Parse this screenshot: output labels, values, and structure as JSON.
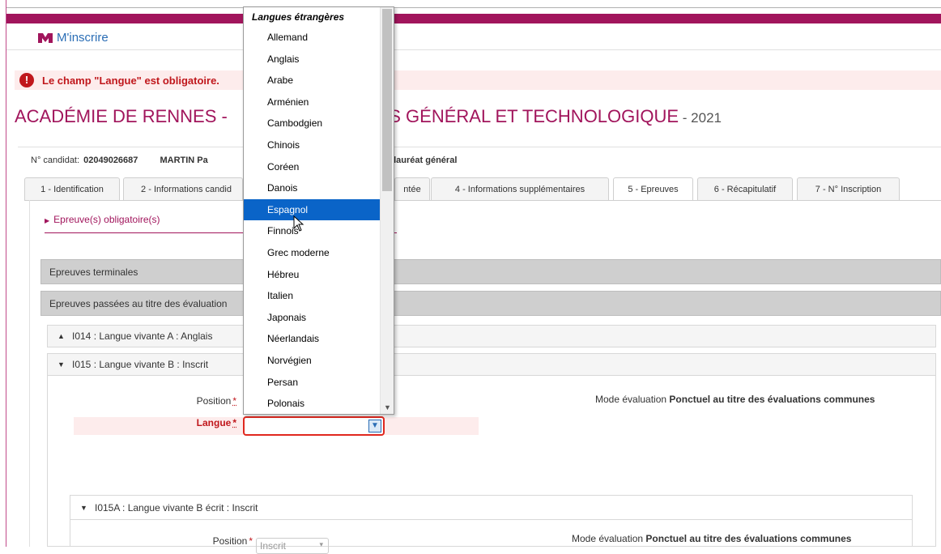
{
  "header": {
    "brand_label": "M'inscrire"
  },
  "alert": {
    "icon": "exclamation-icon",
    "message": "Le champ \"Langue\" est obligatoire."
  },
  "page": {
    "title_start": "ACADÉMIE DE RENNES -",
    "title_end": "TS GÉNÉRAL ET TECHNOLOGIQUE",
    "title_year": " - 2021"
  },
  "candidate": {
    "number_label": "N° candidat:",
    "number_value": "02049026687",
    "name": "MARTIN  Pa",
    "diploma": "alauréat général"
  },
  "tabs": [
    {
      "label": "1 - Identification"
    },
    {
      "label": "2 - Informations candid"
    },
    {
      "label": "ntée"
    },
    {
      "label": "4 - Informations supplémentaires"
    },
    {
      "label": "5 - Epreuves"
    },
    {
      "label": "6 - Récapitulatif"
    },
    {
      "label": "7 - N° Inscription"
    }
  ],
  "section": {
    "link": "Epreuve(s) obligatoire(s)"
  },
  "bars": {
    "terminales": "Epreuves terminales",
    "evaluations": "Epreuves passées au titre des évaluation"
  },
  "panels": {
    "i014": "I014 : Langue vivante A : Anglais",
    "i015": "I015 : Langue vivante B : Inscrit",
    "i015a": "I015A : Langue vivante B écrit : Inscrit"
  },
  "form": {
    "position_label": "Position",
    "required_mark": "*",
    "langue_label": "Langue",
    "langue_value": "",
    "mode_label": "Mode évaluation",
    "mode_value": "Ponctuel au titre des évaluations communes",
    "sub_position_label": "Position",
    "sub_position_value": "Inscrit",
    "sub_mode_label": "Mode évaluation",
    "sub_mode_value": "Ponctuel au titre des évaluations communes"
  },
  "dropdown": {
    "group_label": "Langues étrangères",
    "options": [
      "Allemand",
      "Anglais",
      "Arabe",
      "Arménien",
      "Cambodgien",
      "Chinois",
      "Coréen",
      "Danois",
      "Espagnol",
      "Finnois",
      "Grec moderne",
      "Hébreu",
      "Italien",
      "Japonais",
      "Néerlandais",
      "Norvégien",
      "Persan",
      "Polonais"
    ],
    "highlighted": "Espagnol"
  },
  "colors": {
    "brand": "#a1155c",
    "link": "#2a6db5",
    "error": "#c0171c",
    "selection": "#0a64c8"
  }
}
